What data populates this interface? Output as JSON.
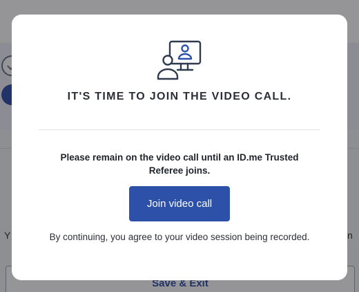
{
  "background": {
    "left_fragment": "Y",
    "right_fragment": "n",
    "save_exit_label": "Save & Exit"
  },
  "modal": {
    "icon": "video-call-agent-icon",
    "title": "IT'S TIME TO JOIN THE VIDEO CALL.",
    "message": "Please remain on the video call until an ID.me Trusted Referee joins.",
    "join_button_label": "Join video call",
    "consent_text": "By continuing, you agree to your video session being recorded."
  },
  "colors": {
    "primary": "#2d51a8",
    "title_text": "#2b2e36",
    "icon_stroke": "#2f3a4f"
  }
}
